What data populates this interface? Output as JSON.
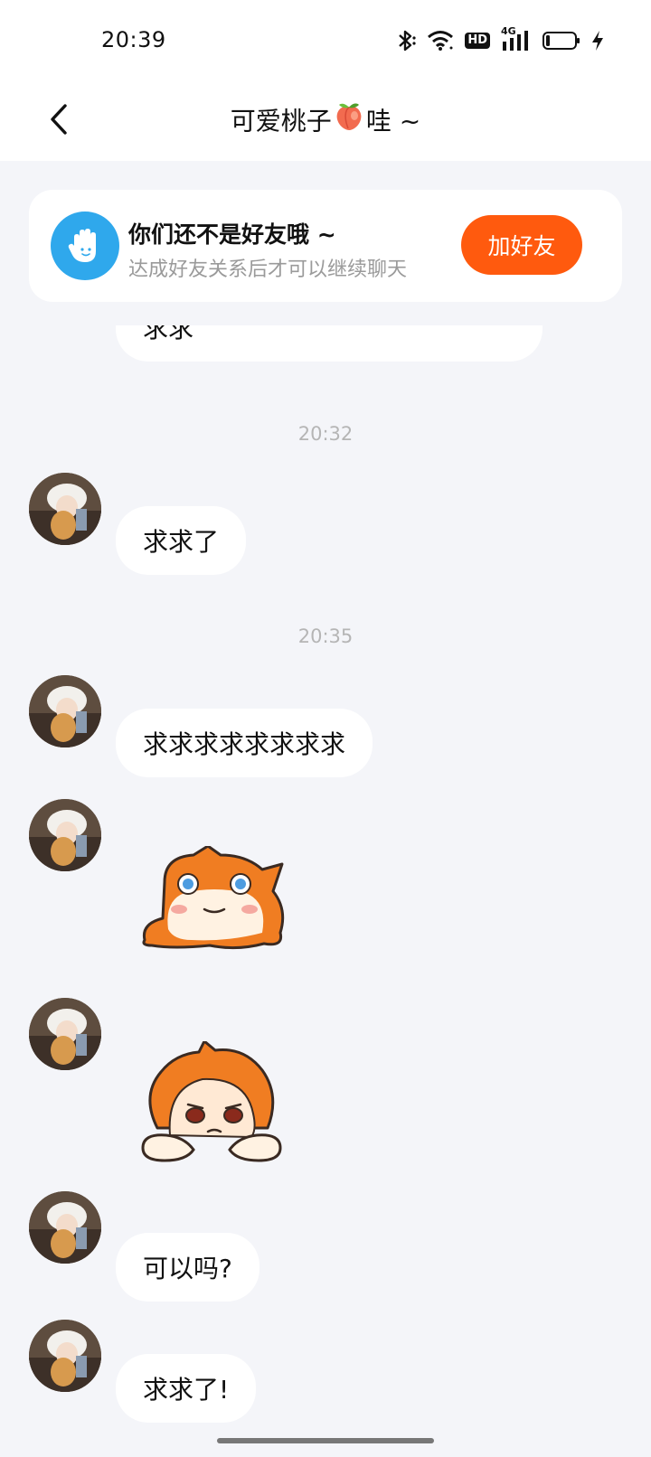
{
  "status_bar": {
    "time": "20:39",
    "network_badge": "HD",
    "signal_label": "4G",
    "icons": [
      "bluetooth-icon",
      "wifi-icon",
      "hd-icon",
      "signal-4g-icon",
      "battery-icon",
      "charging-icon"
    ]
  },
  "header": {
    "title_prefix": "可爱桃子",
    "title_emoji": "peach-icon",
    "title_suffix": "哇 ~",
    "back_icon": "chevron-left-icon"
  },
  "friend_banner": {
    "icon": "hand-icon",
    "title": "你们还不是好友哦 ~",
    "subtitle": "达成好友关系后才可以继续聊天",
    "button_label": "加好友",
    "accent": "#ff5a0e"
  },
  "chat": {
    "messages": [
      {
        "type": "text",
        "text": "求求"
      },
      {
        "type": "time",
        "text": "20:32"
      },
      {
        "type": "text",
        "text": "求求了"
      },
      {
        "type": "time",
        "text": "20:35"
      },
      {
        "type": "text",
        "text": "求求求求求求求求"
      },
      {
        "type": "sticker",
        "name": "crying-cat-sticker"
      },
      {
        "type": "sticker",
        "name": "sad-girl-sticker"
      },
      {
        "type": "text",
        "text": "可以吗?"
      },
      {
        "type": "text",
        "text": "求求了!"
      }
    ]
  }
}
